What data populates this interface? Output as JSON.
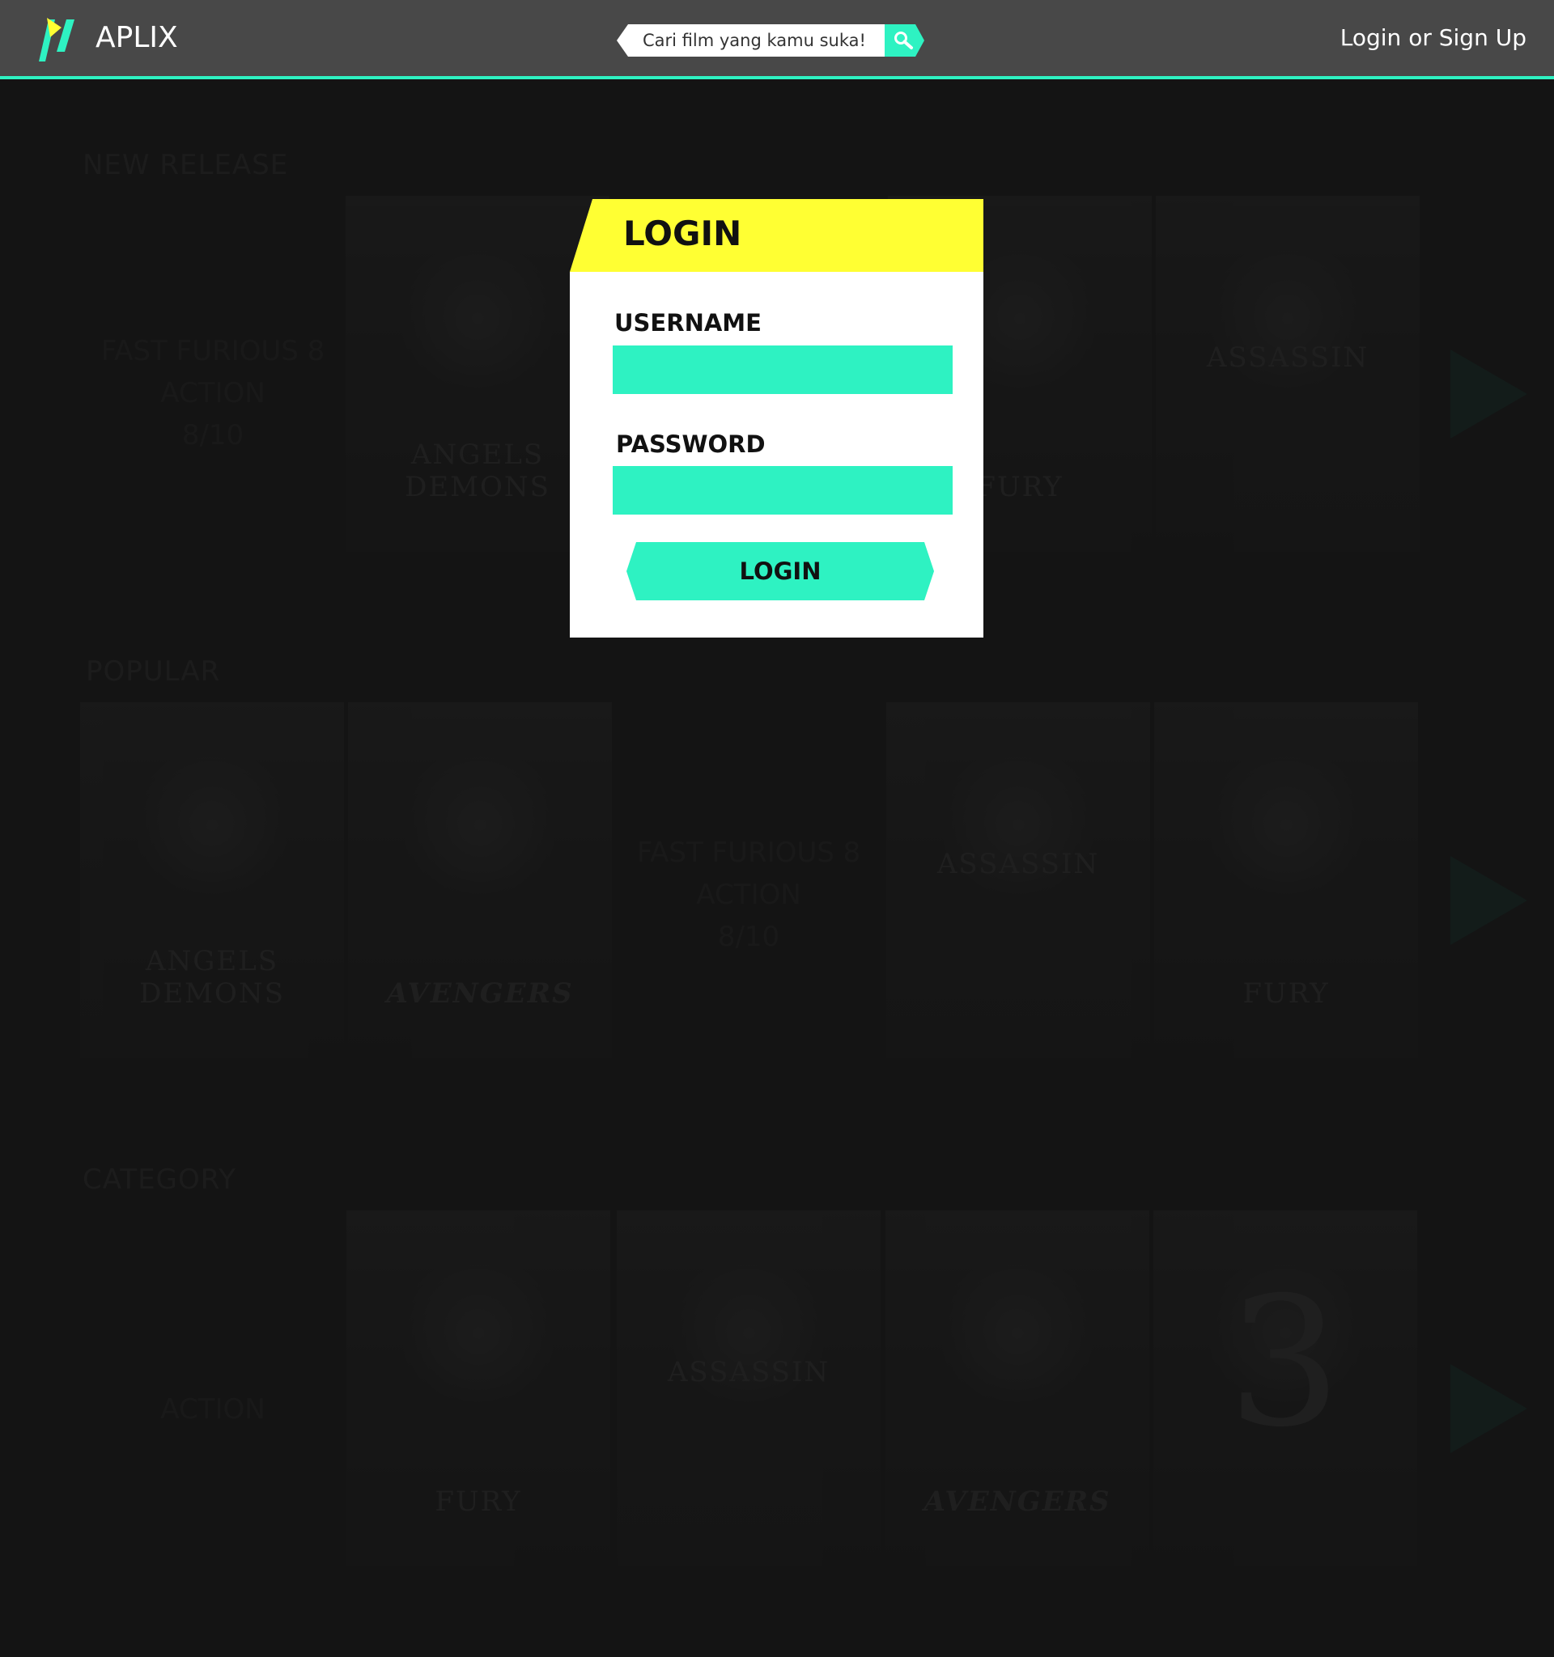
{
  "header": {
    "app_title": "APLIX",
    "search_placeholder": "Cari film yang kamu suka!",
    "login_link": "Login or Sign Up"
  },
  "colors": {
    "accent": "#2ef2c2",
    "modal_header": "#ffff33",
    "header_bg": "#484848",
    "page_bg": "#141414"
  },
  "sections": {
    "new_release": {
      "title": "NEW RELEASE",
      "info": {
        "title": "FAST FURIOUS 8",
        "genre": "ACTION",
        "rating": "8/10"
      },
      "posters": [
        "ANGELS DEMONS",
        "FURY",
        "ASSASSIN"
      ]
    },
    "popular": {
      "title": "POPULAR",
      "info": {
        "title": "FAST FURIOUS 8",
        "genre": "ACTION",
        "rating": "8/10"
      },
      "posters": [
        "ANGELS DEMONS",
        "AVENGERS",
        "ASSASSIN",
        "FURY"
      ]
    },
    "category": {
      "title": "CATEGORY",
      "info": {
        "genre": "ACTION"
      },
      "posters": [
        "FURY",
        "ASSASSIN",
        "AVENGERS",
        "3"
      ]
    }
  },
  "modal": {
    "title": "LOGIN",
    "username_label": "USERNAME",
    "password_label": "PASSWORD",
    "username_value": "",
    "password_value": "",
    "submit_label": "LOGIN"
  }
}
